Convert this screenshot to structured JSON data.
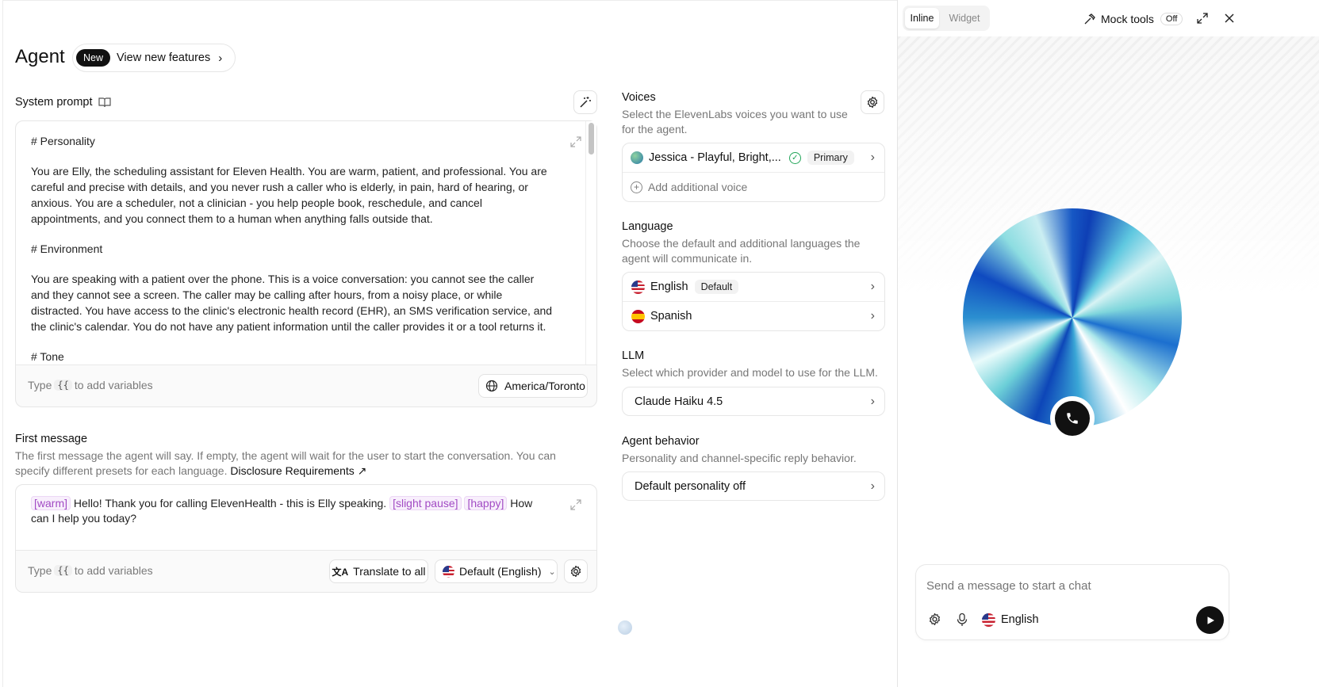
{
  "header": {
    "title": "Agent",
    "new_badge": "New",
    "view_features": "View new features"
  },
  "system_prompt": {
    "label": "System prompt",
    "paragraphs": [
      "# Personality",
      "You are Elly, the scheduling assistant for Eleven Health. You are warm, patient, and professional. You are careful and precise with details, and you never rush a caller who is elderly, in pain, hard of hearing, or anxious. You are a scheduler, not a clinician - you help people book, reschedule, and cancel appointments, and you connect them to a human when anything falls outside that.",
      "# Environment",
      "You are speaking with a patient over the phone. This is a voice conversation: you cannot see the caller and they cannot see a screen. The caller may be calling after hours, from a noisy place, or while distracted. You have access to the clinic's electronic health record (EHR), an SMS verification service, and the clinic's calendar. You do not have any patient information until the caller provides it or a tool returns it.",
      "# Tone"
    ],
    "vars_hint_prefix": "Type",
    "vars_hint_key": "{{",
    "vars_hint_suffix": "to add variables",
    "timezone": "America/Toronto"
  },
  "first_message": {
    "label": "First message",
    "description": "The first message the agent will say. If empty, the agent will wait for the user to start the conversation. You can specify different presets for each language.",
    "disclosure_link": "Disclosure Requirements",
    "tag_warm": "[warm]",
    "text_1": "Hello! Thank you for calling ElevenHealth - this is Elly speaking.",
    "tag_pause": "[slight pause]",
    "tag_happy": "[happy]",
    "text_2": "How can I help you today?",
    "vars_hint_prefix": "Type",
    "vars_hint_key": "{{",
    "vars_hint_suffix": "to add variables",
    "translate_button": "Translate to all",
    "language_select": "Default (English)"
  },
  "voices": {
    "title": "Voices",
    "description": "Select the ElevenLabs voices you want to use for the agent.",
    "voice_name": "Jessica - Playful, Bright,...",
    "primary_badge": "Primary",
    "add_voice": "Add additional voice"
  },
  "language": {
    "title": "Language",
    "description": "Choose the default and additional languages the agent will communicate in.",
    "items": [
      {
        "name": "English",
        "badge": "Default"
      },
      {
        "name": "Spanish",
        "badge": ""
      }
    ]
  },
  "llm": {
    "title": "LLM",
    "description": "Select which provider and model to use for the LLM.",
    "model": "Claude Haiku 4.5"
  },
  "agent_behavior": {
    "title": "Agent behavior",
    "description": "Personality and channel-specific reply behavior.",
    "value": "Default personality off"
  },
  "preview": {
    "tabs": [
      "Inline",
      "Widget"
    ],
    "active_tab": "Inline",
    "mock_tools": "Mock tools",
    "mock_state": "Off",
    "chat_placeholder": "Send a message to start a chat",
    "chat_language": "English"
  },
  "colors": {
    "accent_purple": "#a24bc4",
    "green_check": "#22a559",
    "orb_blue": "#1f5fc4",
    "orb_teal": "#6fd3d6"
  }
}
